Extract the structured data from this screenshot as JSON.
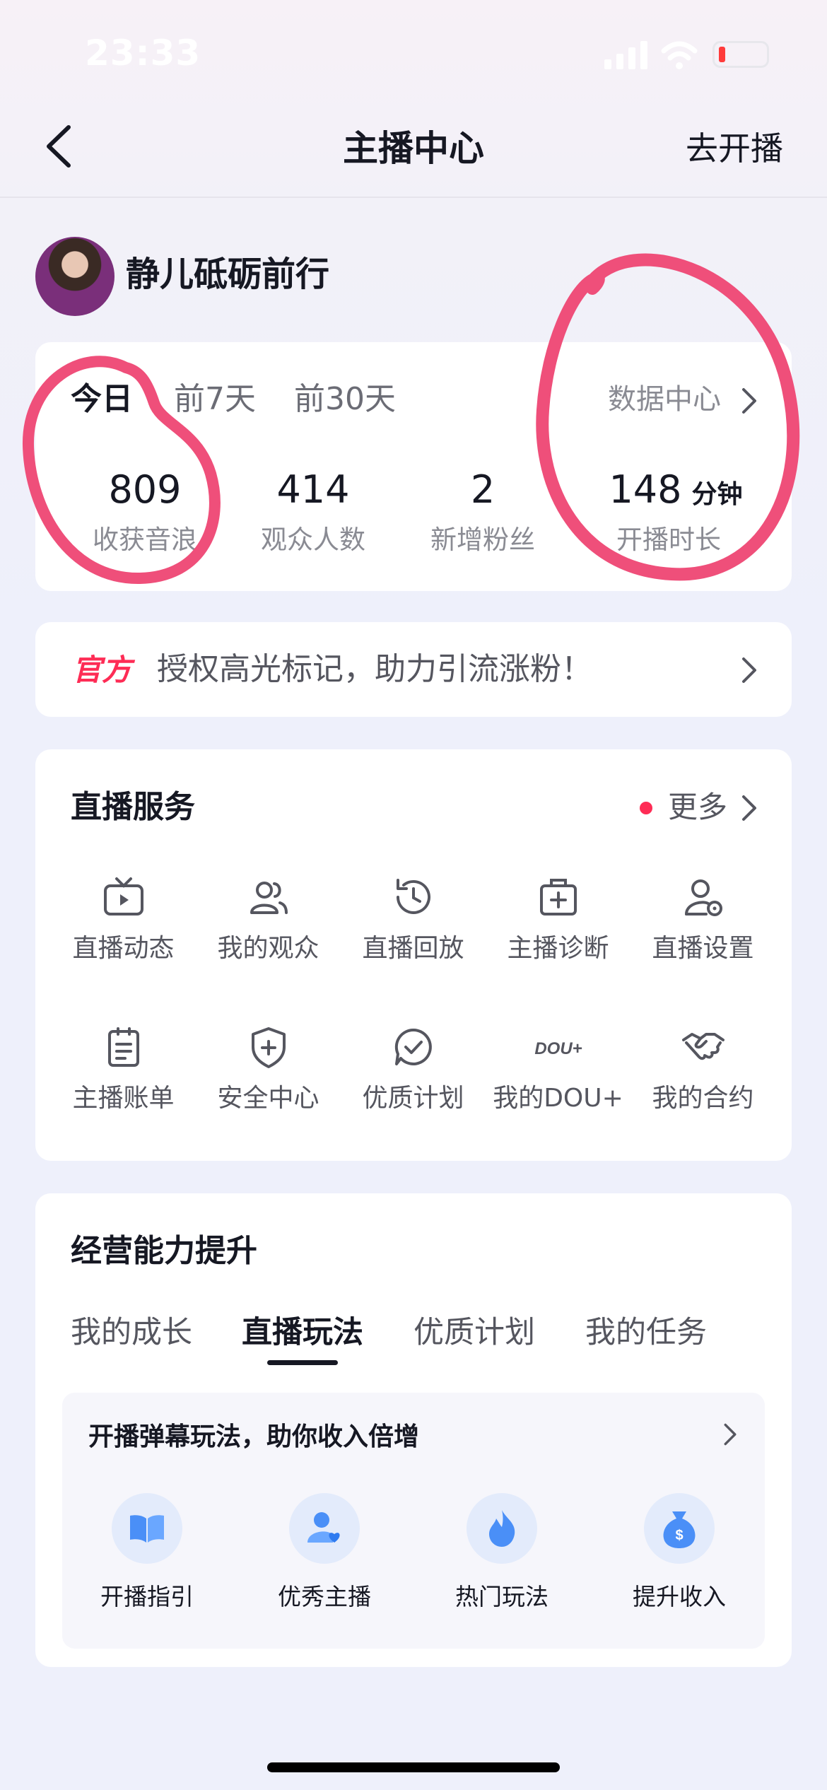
{
  "status_bar": {
    "time": "23:33"
  },
  "nav": {
    "title": "主播中心",
    "go_live": "去开播"
  },
  "profile": {
    "name": "静儿砥砺前行"
  },
  "stats": {
    "tabs": [
      "今日",
      "前7天",
      "前30天"
    ],
    "active_tab": "今日",
    "data_center": "数据中心",
    "items": [
      {
        "value": "809",
        "label": "收获音浪"
      },
      {
        "value": "414",
        "label": "观众人数"
      },
      {
        "value": "2",
        "label": "新增粉丝"
      },
      {
        "value": "148",
        "unit": "分钟",
        "label": "开播时长"
      }
    ]
  },
  "banner": {
    "tag": "官方",
    "text": "授权高光标记，助力引流涨粉！"
  },
  "live_services": {
    "title": "直播服务",
    "more": "更多",
    "items": [
      {
        "label": "直播动态",
        "icon": "tv-icon"
      },
      {
        "label": "我的观众",
        "icon": "users-icon"
      },
      {
        "label": "直播回放",
        "icon": "replay-clock-icon"
      },
      {
        "label": "主播诊断",
        "icon": "medical-kit-icon"
      },
      {
        "label": "直播设置",
        "icon": "user-settings-icon"
      },
      {
        "label": "主播账单",
        "icon": "bill-icon"
      },
      {
        "label": "安全中心",
        "icon": "shield-plus-icon"
      },
      {
        "label": "优质计划",
        "icon": "check-bubble-icon"
      },
      {
        "label": "我的DOU+",
        "icon": "dou-plus-icon",
        "icon_text": "DOU+"
      },
      {
        "label": "我的合约",
        "icon": "handshake-icon"
      }
    ]
  },
  "growth": {
    "title": "经营能力提升",
    "tabs": [
      "我的成长",
      "直播玩法",
      "优质计划",
      "我的任务"
    ],
    "active_tab": "直播玩法",
    "panel": {
      "title": "开播弹幕玩法，助你收入倍增",
      "items": [
        {
          "label": "开播指引",
          "icon": "book-icon"
        },
        {
          "label": "优秀主播",
          "icon": "user-heart-icon"
        },
        {
          "label": "热门玩法",
          "icon": "flame-icon"
        },
        {
          "label": "提升收入",
          "icon": "money-bag-icon"
        }
      ]
    }
  },
  "colors": {
    "accent": "#fe2c55",
    "annotation_circle": "#ef4f7a",
    "text": "#161823",
    "muted": "#8a8b93"
  }
}
